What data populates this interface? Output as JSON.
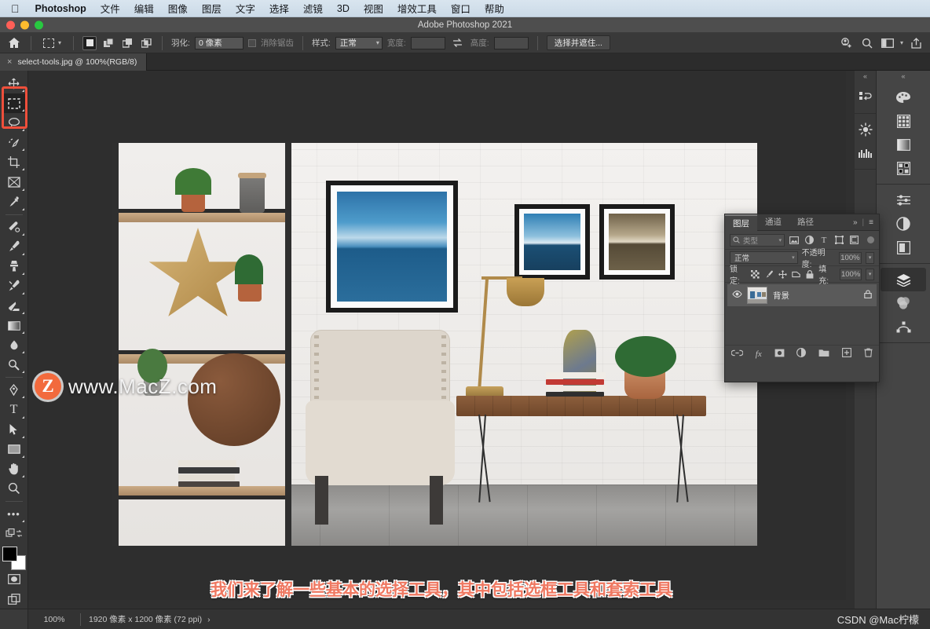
{
  "macbar": {
    "apple_icon": "apple-logo",
    "app_name": "Photoshop",
    "menus": [
      "文件",
      "编辑",
      "图像",
      "图层",
      "文字",
      "选择",
      "滤镜",
      "3D",
      "视图",
      "增效工具",
      "窗口",
      "帮助"
    ]
  },
  "window": {
    "title": "Adobe Photoshop 2021"
  },
  "options_bar": {
    "home_icon": "home-icon",
    "tool_preset_icon": "rectangular-marquee-icon",
    "preset_chevron": "▾",
    "selection_modes": [
      "new-selection",
      "add-to-selection",
      "subtract-from-selection",
      "intersect-with-selection"
    ],
    "feather_label": "羽化:",
    "feather_value": "0 像素",
    "antialias_label": "消除锯齿",
    "style_label": "样式:",
    "style_value": "正常",
    "width_label": "宽度:",
    "width_value": "",
    "swap_icon": "swap-arrows-icon",
    "height_label": "高度:",
    "height_value": "",
    "select_and_mask": "选择并遮住...",
    "right_icons": [
      "add-person-icon",
      "search-icon",
      "workspace-icon",
      "share-icon"
    ]
  },
  "document_tab": {
    "close_icon": "×",
    "title": "select-tools.jpg @ 100%(RGB/8)"
  },
  "toolbar": {
    "tools": [
      {
        "name": "move-tool",
        "selected": false
      },
      {
        "name": "rectangular-marquee-tool",
        "selected": true
      },
      {
        "name": "lasso-tool",
        "selected": false
      },
      {
        "name": "quick-selection-tool",
        "selected": false
      },
      {
        "name": "crop-tool",
        "selected": false
      },
      {
        "name": "frame-tool",
        "selected": false
      },
      {
        "name": "eyedropper-tool",
        "selected": false
      },
      {
        "name": "spot-healing-brush-tool",
        "selected": false
      },
      {
        "name": "brush-tool",
        "selected": false
      },
      {
        "name": "clone-stamp-tool",
        "selected": false
      },
      {
        "name": "history-brush-tool",
        "selected": false
      },
      {
        "name": "eraser-tool",
        "selected": false
      },
      {
        "name": "gradient-tool",
        "selected": false
      },
      {
        "name": "blur-tool",
        "selected": false
      },
      {
        "name": "dodge-tool",
        "selected": false
      },
      {
        "name": "pen-tool",
        "selected": false
      },
      {
        "name": "type-tool",
        "selected": false
      },
      {
        "name": "path-selection-tool",
        "selected": false
      },
      {
        "name": "rectangle-tool",
        "selected": false
      },
      {
        "name": "hand-tool",
        "selected": false
      },
      {
        "name": "zoom-tool",
        "selected": false
      },
      {
        "name": "edit-toolbar-tool",
        "selected": false
      }
    ],
    "type_glyph": "T",
    "more_glyph": "•••",
    "foreground_color": "#000000",
    "background_color": "#ffffff",
    "highlight_color": "#ee4f3b"
  },
  "canvas": {
    "image_alt": "room interior with shelves, framed art, chair and bench",
    "watermark_logo": "Z",
    "watermark_text": "www.MacZ.com",
    "subtitle": "我们来了解一些基本的选择工具，其中包括选框工具和套索工具"
  },
  "layers_panel": {
    "tabs": [
      {
        "label": "图层",
        "active": true
      },
      {
        "label": "通道",
        "active": false
      },
      {
        "label": "路径",
        "active": false
      }
    ],
    "collapse_icon": "»",
    "menu_icon": "≡",
    "filter": {
      "search_icon": "search-icon",
      "kind_label": "类型",
      "kind_chevron": "▾",
      "filter_icons": [
        "pixel-filter-icon",
        "adjustment-filter-icon",
        "type-filter-icon",
        "shape-filter-icon",
        "smart-object-filter-icon"
      ],
      "toggle_name": "filter-toggle"
    },
    "blend_mode": "正常",
    "opacity_label": "不透明度:",
    "opacity_value": "100%",
    "lock_label": "锁定:",
    "lock_icons": [
      "lock-transparent-pixels",
      "lock-image-pixels",
      "lock-position",
      "lock-artboard-nesting",
      "lock-all"
    ],
    "fill_label": "填充:",
    "fill_value": "100%",
    "layers": [
      {
        "name": "背景",
        "visible": true,
        "locked": true,
        "eye_icon": "eye-icon",
        "lock_icon": "lock-icon"
      }
    ],
    "footer_icons": [
      "link-layers-icon",
      "layer-style-icon",
      "layer-mask-icon",
      "adjustment-layer-icon",
      "new-group-icon",
      "new-layer-icon",
      "delete-layer-icon"
    ],
    "footer_fx_label": "fx"
  },
  "right_dock": {
    "narrow_icons": [
      "history-icon",
      "adjustments-preset-icon",
      "libraries-icon"
    ],
    "wide_icons": [
      {
        "name": "color-panel-icon",
        "selected": false
      },
      {
        "name": "swatches-panel-icon",
        "selected": false
      },
      {
        "name": "gradients-panel-icon",
        "selected": false
      },
      {
        "name": "patterns-panel-icon",
        "selected": false
      },
      {
        "name": "adjustments-panel-icon",
        "selected": false
      },
      {
        "name": "properties-panel-icon",
        "selected": false
      },
      {
        "name": "libraries-panel-icon",
        "selected": false
      },
      {
        "name": "layers-panel-icon",
        "selected": true
      },
      {
        "name": "channels-panel-icon",
        "selected": false
      },
      {
        "name": "paths-panel-icon",
        "selected": false
      }
    ],
    "collapse_icon": "«"
  },
  "status_bar": {
    "zoom": "100%",
    "dimensions": "1920 像素 x 1200 像素 (72 ppi)",
    "expand_icon": "›",
    "watermark": "CSDN @Mac柠檬"
  }
}
